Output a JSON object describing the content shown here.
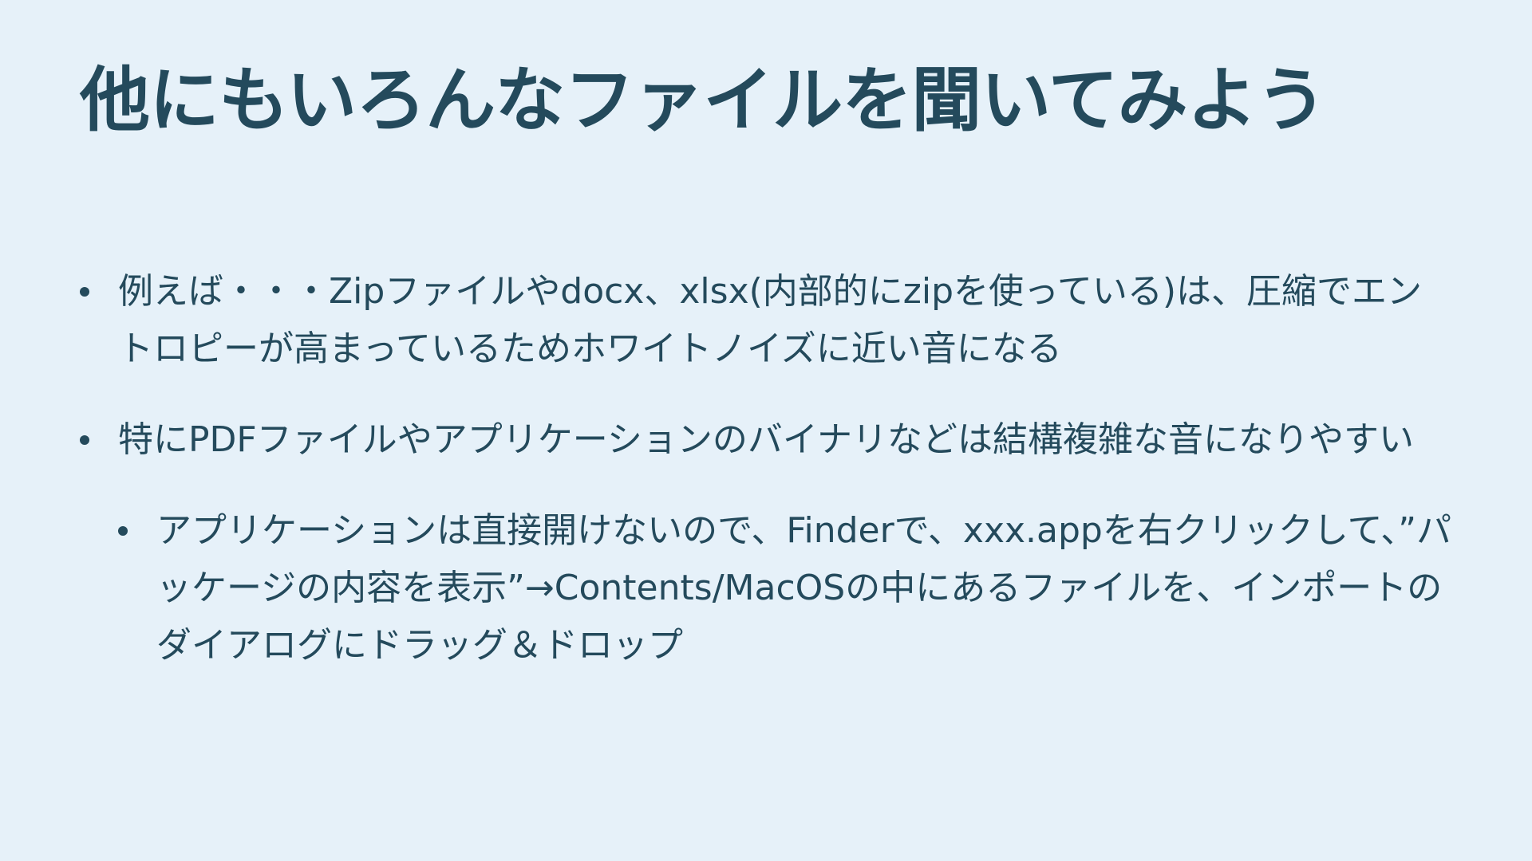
{
  "slide": {
    "title": "他にもいろんなファイルを聞いてみよう",
    "bullets": [
      {
        "text": "例えば・・・Zipファイルやdocx、xlsx(内部的にzipを使っている)は、圧縮でエントロピーが高まっているためホワイトノイズに近い音になる"
      },
      {
        "text": "特にPDFファイルやアプリケーションのバイナリなどは結構複雑な音になりやすい"
      },
      {
        "text": "アプリケーションは直接開けないので、Finderで、xxx.appを右クリックして、”パッケージの内容を表示”→Contents/MacOSの中にあるファイルを、インポートのダイアログにドラッグ＆ドロップ"
      }
    ]
  }
}
